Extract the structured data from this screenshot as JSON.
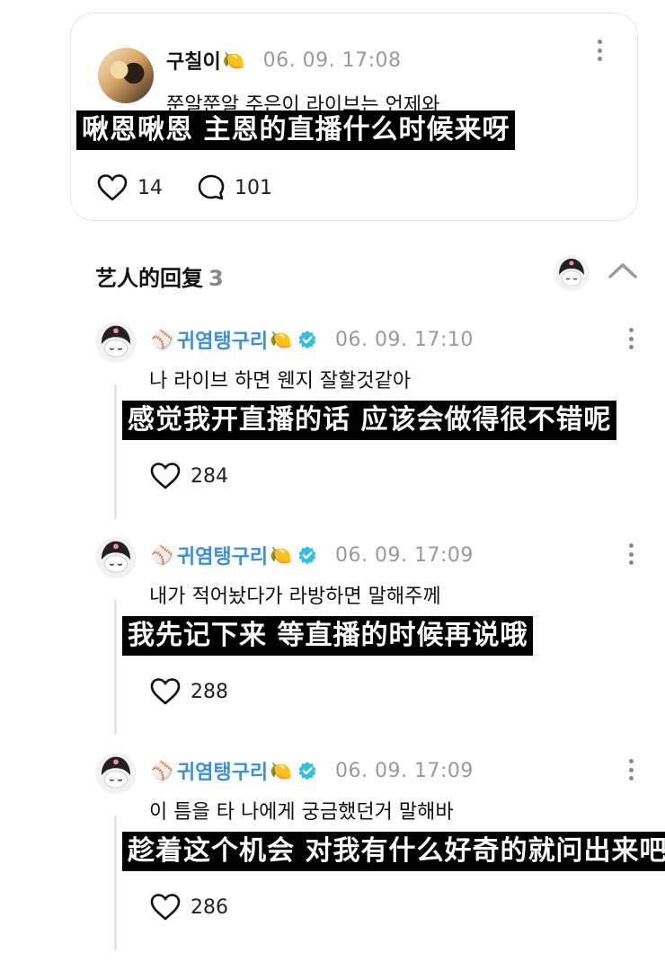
{
  "post": {
    "author": "구칠이",
    "emoji": "🍋",
    "time": "06. 09. 17:08",
    "text": "쭌알쭌알 주은이 라이브는 언제와",
    "subtitle": "啾恩啾恩 主恩的直播什么时候来呀",
    "likes": "14",
    "comments": "101"
  },
  "replies_section": {
    "title": "艺人的回复",
    "count": "3"
  },
  "replies": [
    {
      "baseball": "⚾",
      "author": "귀염탱구리",
      "emoji": "🍋",
      "time": "06. 09. 17:10",
      "text": "나 라이브 하면 웬지 잘할것같아",
      "subtitle": "感觉我开直播的话 应该会做得很不错呢",
      "likes": "284"
    },
    {
      "baseball": "⚾",
      "author": "귀염탱구리",
      "emoji": "🍋",
      "time": "06. 09. 17:09",
      "text": "내가 적어놨다가 라방하면 말해주께",
      "subtitle": "我先记下来 等直播的时候再说哦",
      "likes": "288"
    },
    {
      "baseball": "⚾",
      "author": "귀염탱구리",
      "emoji": "🍋",
      "time": "06. 09. 17:09",
      "text": "이 틈을 타 나에게 궁금했던거 말해바",
      "subtitle": "趁着这个机会 对我有什么好奇的就问出来吧",
      "likes": "286"
    }
  ],
  "colors": {
    "artist_name": "#3a8fe0",
    "verified_badge": "#35c0d8",
    "subtitle_bg": "#000000",
    "muted": "#9a9a9a"
  },
  "icons": [
    "heart-icon",
    "comment-icon",
    "kebab-menu-icon",
    "chevron-up-icon",
    "verified-badge-icon",
    "baseball-icon",
    "lemon-icon"
  ]
}
